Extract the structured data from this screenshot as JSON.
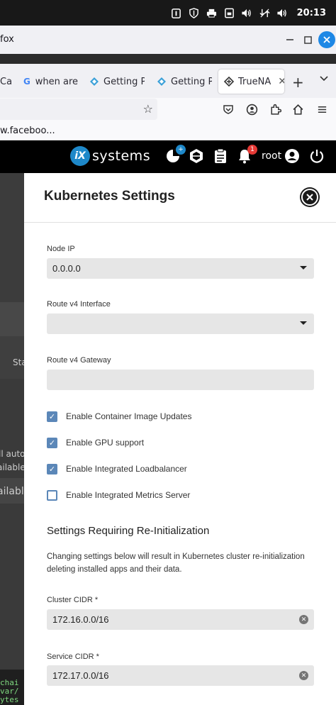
{
  "os": {
    "clock": "20:13"
  },
  "browser": {
    "app_name": "fox",
    "tabs": [
      {
        "label": "Ca"
      },
      {
        "label": "when are"
      },
      {
        "label": "Getting Pl"
      },
      {
        "label": "Getting Pl"
      },
      {
        "label": "TrueNA"
      }
    ],
    "bookmark": "w.faceboo..."
  },
  "truenas": {
    "logo": "systems",
    "notifications_count": "1",
    "user": "root"
  },
  "background": {
    "items": [
      "Sta",
      "ll auto",
      "ailable",
      "ailable"
    ],
    "terminal": [
      "chai",
      "var/",
      "ytes"
    ]
  },
  "panel": {
    "title": "Kubernetes Settings",
    "node_ip": {
      "label": "Node IP",
      "value": "0.0.0.0"
    },
    "route_v4_interface": {
      "label": "Route v4 Interface",
      "value": ""
    },
    "route_v4_gateway": {
      "label": "Route v4 Gateway",
      "value": ""
    },
    "checkboxes": [
      {
        "label": "Enable Container Image Updates",
        "checked": true
      },
      {
        "label": "Enable GPU support",
        "checked": true
      },
      {
        "label": "Enable Integrated Loadbalancer",
        "checked": true
      },
      {
        "label": "Enable Integrated Metrics Server",
        "checked": false
      }
    ],
    "reinit_section": {
      "title": "Settings Requiring Re-Initialization",
      "note": "Changing settings below will result in Kubernetes cluster re-initialization deleting installed apps and their data."
    },
    "cluster_cidr": {
      "label": "Cluster CIDR *",
      "value": "172.16.0.0/16"
    },
    "service_cidr": {
      "label": "Service CIDR *",
      "value": "172.17.0.0/16"
    }
  },
  "colors": {
    "accent": "#5b87b8",
    "header": "#000000",
    "ix_blue": "#1e88c9"
  }
}
